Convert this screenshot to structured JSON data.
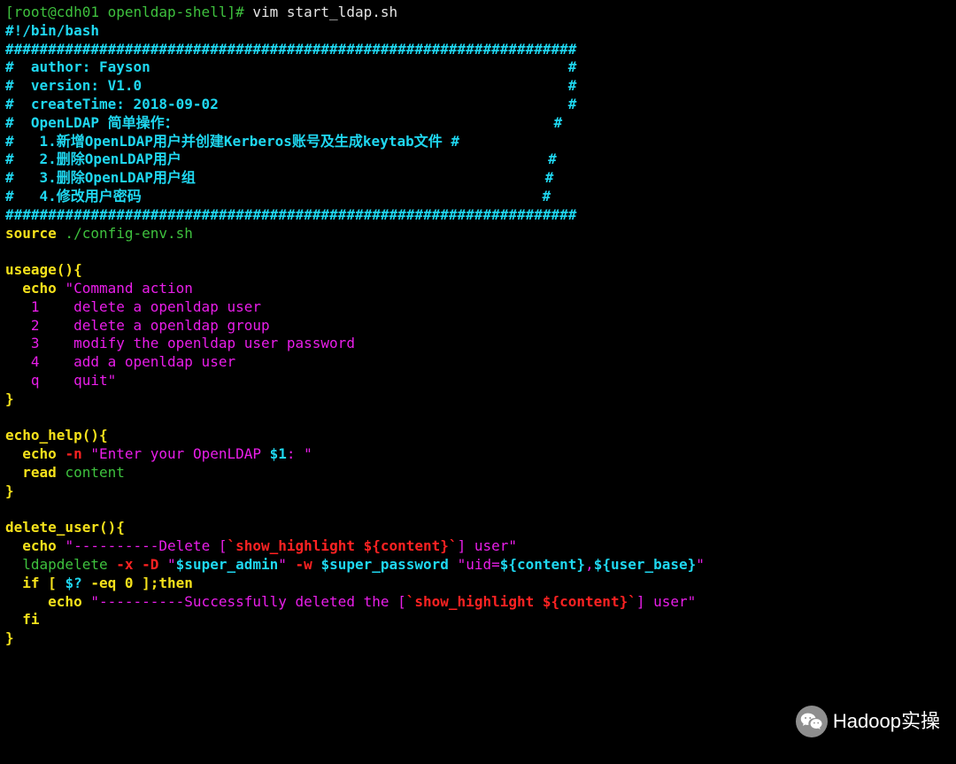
{
  "prompt": {
    "user_host": "[root@cdh01 openldap-shell]#",
    "cmd": " vim start_ldap.sh"
  },
  "header": {
    "shebang": "#!/bin/bash",
    "hr": "###################################################################",
    "h1": "#  author: Fayson                                                 #",
    "h2": "#  version: V1.0                                                  #",
    "h3": "#  createTime: 2018-09-02                                         #",
    "h4": "#  OpenLDAP 简单操作：                                            #",
    "h5": "#   1.新增OpenLDAP用户并创建Kerberos账号及生成keytab文件 #",
    "h6": "#   2.删除OpenLDAP用户                                           #",
    "h7": "#   3.删除OpenLDAP用户组                                         #",
    "h8": "#   4.修改用户密码                                               #"
  },
  "source": {
    "kw": "source",
    "path": " ./config-env.sh"
  },
  "useage": {
    "def": "useage(){",
    "echo": "  echo ",
    "q1": "\"Command action",
    "l1": "   1    delete a openldap user",
    "l2": "   2    delete a openldap group",
    "l3": "   3    modify the openldap user password",
    "l4": "   4    add a openldap user",
    "l5": "   q    quit\"",
    "close": "}"
  },
  "echo_help": {
    "def": "echo_help(){",
    "echo": "  echo ",
    "flag": "-n ",
    "str1": "\"Enter your OpenLDAP ",
    "var": "$1",
    "str2": ": \"",
    "read": "  read ",
    "content": "content",
    "close": "}"
  },
  "delete_user": {
    "def": "delete_user(){",
    "e1": "  echo ",
    "s1a": "\"----------Delete [",
    "bt1": "`show_highlight ${content}`",
    "s1b": "] user\"",
    "cmd": "  ldapdelete ",
    "f1": "-x -D ",
    "q1": "\"",
    "v1": "$super_admin",
    "q2": "\" ",
    "f2": "-w ",
    "v2": "$super_password ",
    "q3": "\"uid=",
    "v3": "${content}",
    "mid": ",",
    "v4": "${user_base}",
    "q4": "\"",
    "if": "  if ",
    "cond1": "[ ",
    "sv": "$?",
    "cond2": " -eq 0 ]",
    "then": ";then",
    "e2": "     echo ",
    "s2a": "\"----------Successfully deleted the [",
    "bt2": "`show_highlight ${content}`",
    "s2b": "] user\"",
    "fi": "  fi",
    "close": "}"
  },
  "watermark": "Hadoop实操"
}
